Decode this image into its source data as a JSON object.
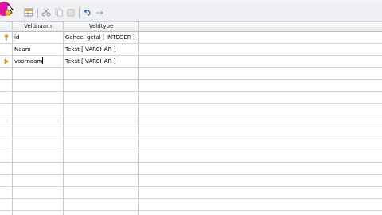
{
  "toolbar": {
    "buttons": [
      {
        "icon": "primary-key-icon"
      },
      {
        "icon": "table-icon"
      },
      {
        "icon": "cut-icon"
      },
      {
        "icon": "copy-icon"
      },
      {
        "icon": "paste-icon"
      },
      {
        "icon": "undo-icon"
      },
      {
        "icon": "redo-icon"
      }
    ]
  },
  "grid": {
    "columns": [
      "Veldnaam",
      "Veldtype"
    ],
    "rows": [
      {
        "marker": "key-icon",
        "name": "id",
        "type": "Geheel getal [ INTEGER ]"
      },
      {
        "marker": "",
        "name": "Naam",
        "type": "Tekst [ VARCHAR ]"
      },
      {
        "marker": "current-row-arrow-icon",
        "name": "voornaam",
        "type": "Tekst [ VARCHAR ]"
      }
    ]
  }
}
